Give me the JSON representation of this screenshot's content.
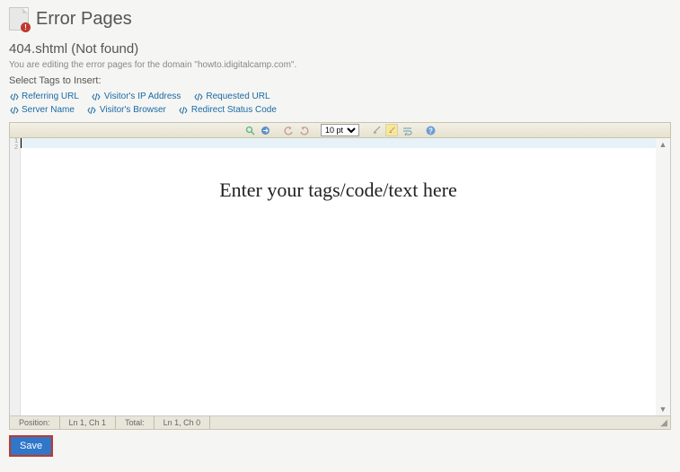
{
  "header": {
    "title": "Error Pages",
    "icon_badge": "!"
  },
  "sub": {
    "file_title": "404.shtml (Not found)",
    "desc": "You are editing the error pages for the domain \"howto.idigitalcamp.com\".",
    "select_label": "Select Tags to Insert:"
  },
  "tags_row1": [
    {
      "label": "Referring URL"
    },
    {
      "label": "Visitor's IP Address"
    },
    {
      "label": "Requested URL"
    }
  ],
  "tags_row2": [
    {
      "label": "Server Name"
    },
    {
      "label": "Visitor's Browser"
    },
    {
      "label": "Redirect Status Code"
    }
  ],
  "toolbar": {
    "font_size_value": "10 pt"
  },
  "editor": {
    "line_numbers": [
      "1",
      "2"
    ],
    "placeholder": "Enter your tags/code/text here"
  },
  "statusbar": {
    "pos_label": "Position:",
    "pos_val": "Ln 1, Ch 1",
    "tot_label": "Total:",
    "tot_val": "Ln 1, Ch 0"
  },
  "actions": {
    "save": "Save"
  }
}
